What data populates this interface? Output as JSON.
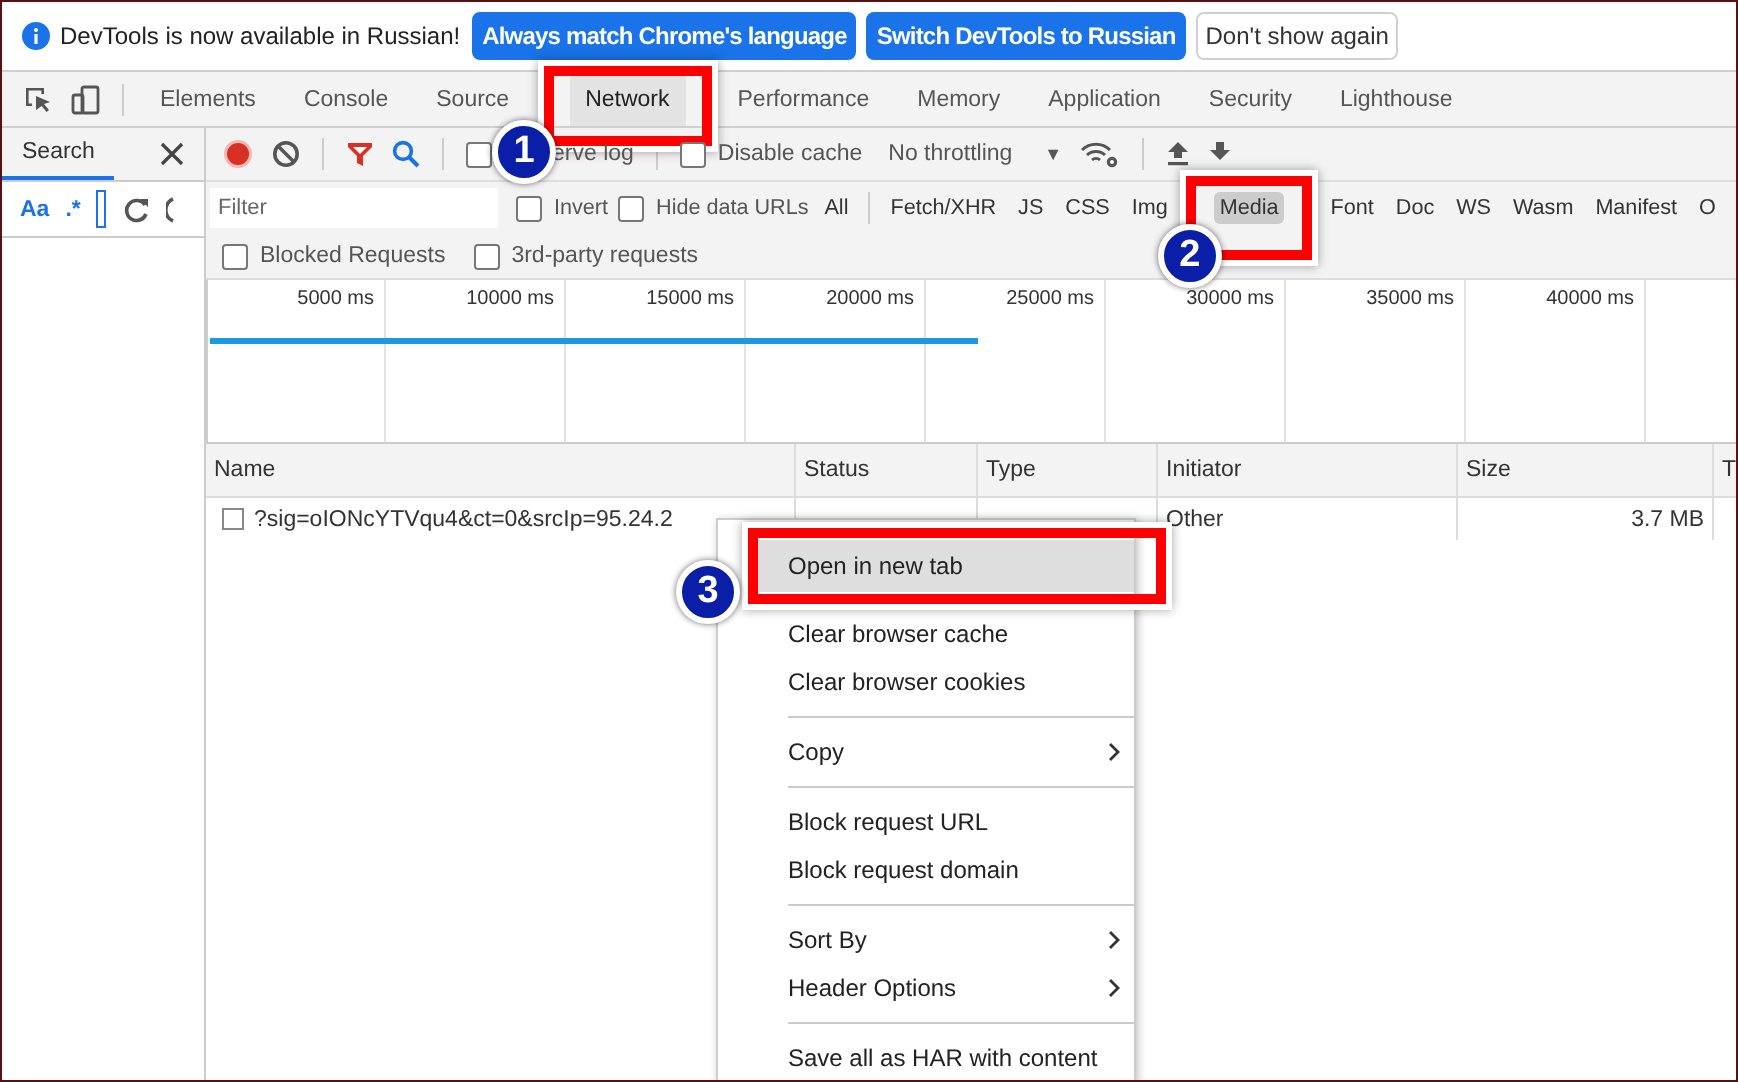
{
  "infobar": {
    "message": "DevTools is now available in Russian!",
    "buttons": [
      {
        "label": "Always match Chrome's language",
        "kind": "primary"
      },
      {
        "label": "Switch DevTools to Russian",
        "kind": "primary"
      },
      {
        "label": "Don't show again",
        "kind": "plain"
      }
    ]
  },
  "tabs": [
    {
      "label": "Elements",
      "selected": false
    },
    {
      "label": "Console",
      "selected": false
    },
    {
      "label": "Source",
      "selected": false
    },
    {
      "label": "Network",
      "selected": true
    },
    {
      "label": "Performance",
      "selected": false
    },
    {
      "label": "Memory",
      "selected": false
    },
    {
      "label": "Application",
      "selected": false
    },
    {
      "label": "Security",
      "selected": false
    },
    {
      "label": "Lighthouse",
      "selected": false
    }
  ],
  "search_panel": {
    "title": "Search",
    "case_toggle": "Aa",
    "regex_toggle": ".*"
  },
  "toolbar": {
    "preserve_log": {
      "label": "erve log",
      "checked": false
    },
    "disable_cache": {
      "label": "Disable cache",
      "checked": false
    },
    "throttling": "No throttling",
    "dropdown_glyph": "▼"
  },
  "filter": {
    "placeholder": "Filter",
    "invert": {
      "label": "Invert",
      "checked": false
    },
    "hide_data_urls": {
      "label": "Hide data URLs",
      "checked": false
    },
    "types": [
      {
        "label": "All",
        "selected": false
      },
      {
        "label": "Fetch/XHR",
        "selected": false
      },
      {
        "label": "JS",
        "selected": false
      },
      {
        "label": "CSS",
        "selected": false
      },
      {
        "label": "Img",
        "selected": false
      },
      {
        "label": "Media",
        "selected": true
      },
      {
        "label": "Font",
        "selected": false
      },
      {
        "label": "Doc",
        "selected": false
      },
      {
        "label": "WS",
        "selected": false
      },
      {
        "label": "Wasm",
        "selected": false
      },
      {
        "label": "Manifest",
        "selected": false
      },
      {
        "label": "O",
        "selected": false
      }
    ],
    "blocked_requests": {
      "label": "Blocked Requests",
      "checked": false
    },
    "third_party": {
      "label": "3rd-party requests",
      "checked": false
    }
  },
  "timeline": {
    "ticks": [
      "5000 ms",
      "10000 ms",
      "15000 ms",
      "20000 ms",
      "25000 ms",
      "30000 ms",
      "35000 ms",
      "40000 ms"
    ]
  },
  "table": {
    "columns": [
      "Name",
      "Status",
      "Type",
      "Initiator",
      "Size",
      "T"
    ],
    "rows": [
      {
        "checked": false,
        "name": "?sig=oIONcYTVqu4&ct=0&srcIp=95.24.2",
        "status": "",
        "type": "",
        "initiator": "Other",
        "size": "3.7 MB"
      }
    ]
  },
  "context_menu": {
    "items": [
      {
        "kind": "item",
        "label": "Open in new tab",
        "submenu": false,
        "selected": true
      },
      {
        "kind": "item",
        "label": "Clear browser cache",
        "submenu": false,
        "selected": false
      },
      {
        "kind": "item",
        "label": "Clear browser cookies",
        "submenu": false,
        "selected": false
      },
      {
        "kind": "separator"
      },
      {
        "kind": "item",
        "label": "Copy",
        "submenu": true,
        "selected": false
      },
      {
        "kind": "separator"
      },
      {
        "kind": "item",
        "label": "Block request URL",
        "submenu": false,
        "selected": false
      },
      {
        "kind": "item",
        "label": "Block request domain",
        "submenu": false,
        "selected": false
      },
      {
        "kind": "separator"
      },
      {
        "kind": "item",
        "label": "Sort By",
        "submenu": true,
        "selected": false
      },
      {
        "kind": "item",
        "label": "Header Options",
        "submenu": true,
        "selected": false
      },
      {
        "kind": "separator"
      },
      {
        "kind": "item",
        "label": "Save all as HAR with content",
        "submenu": false,
        "selected": false
      }
    ]
  },
  "annotations": [
    {
      "number": "1"
    },
    {
      "number": "2"
    },
    {
      "number": "3"
    }
  ]
}
